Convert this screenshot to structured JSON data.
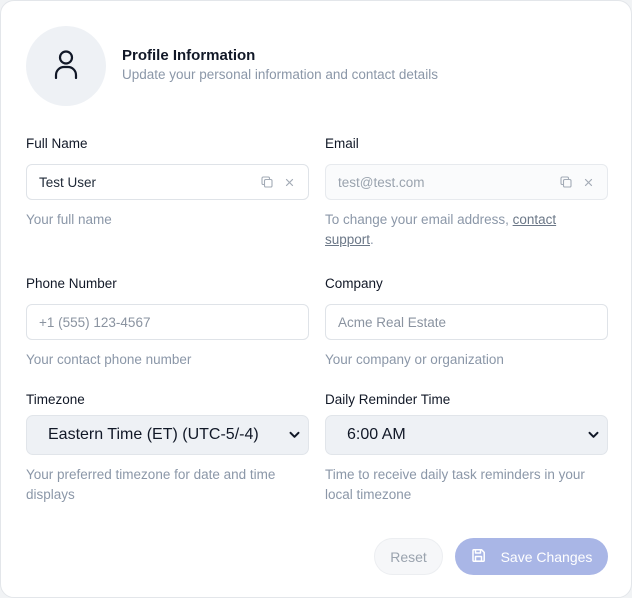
{
  "header": {
    "title": "Profile Information",
    "subtitle": "Update your personal information and contact details",
    "avatar_icon": "user-icon"
  },
  "fields": {
    "full_name": {
      "label": "Full Name",
      "value": "Test User",
      "helper": "Your full name"
    },
    "email": {
      "label": "Email",
      "value": "test@test.com",
      "helper_prefix": "To change your email address, ",
      "helper_link": "contact support",
      "helper_suffix": "."
    },
    "phone": {
      "label": "Phone Number",
      "placeholder": "+1 (555) 123-4567",
      "helper": "Your contact phone number"
    },
    "company": {
      "label": "Company",
      "placeholder": "Acme Real Estate",
      "helper": "Your company or organization"
    },
    "timezone": {
      "label": "Timezone",
      "value": "Eastern Time (ET) (UTC-5/-4)",
      "helper": "Your preferred timezone for date and time displays"
    },
    "reminder": {
      "label": "Daily Reminder Time",
      "value": "6:00 AM",
      "helper": "Time to receive daily task reminders in your local timezone"
    }
  },
  "actions": {
    "reset_label": "Reset",
    "save_label": "Save Changes",
    "save_icon": "save-icon"
  },
  "colors": {
    "accent_disabled": "#a9b6e6",
    "muted_text": "#8b97a8"
  }
}
